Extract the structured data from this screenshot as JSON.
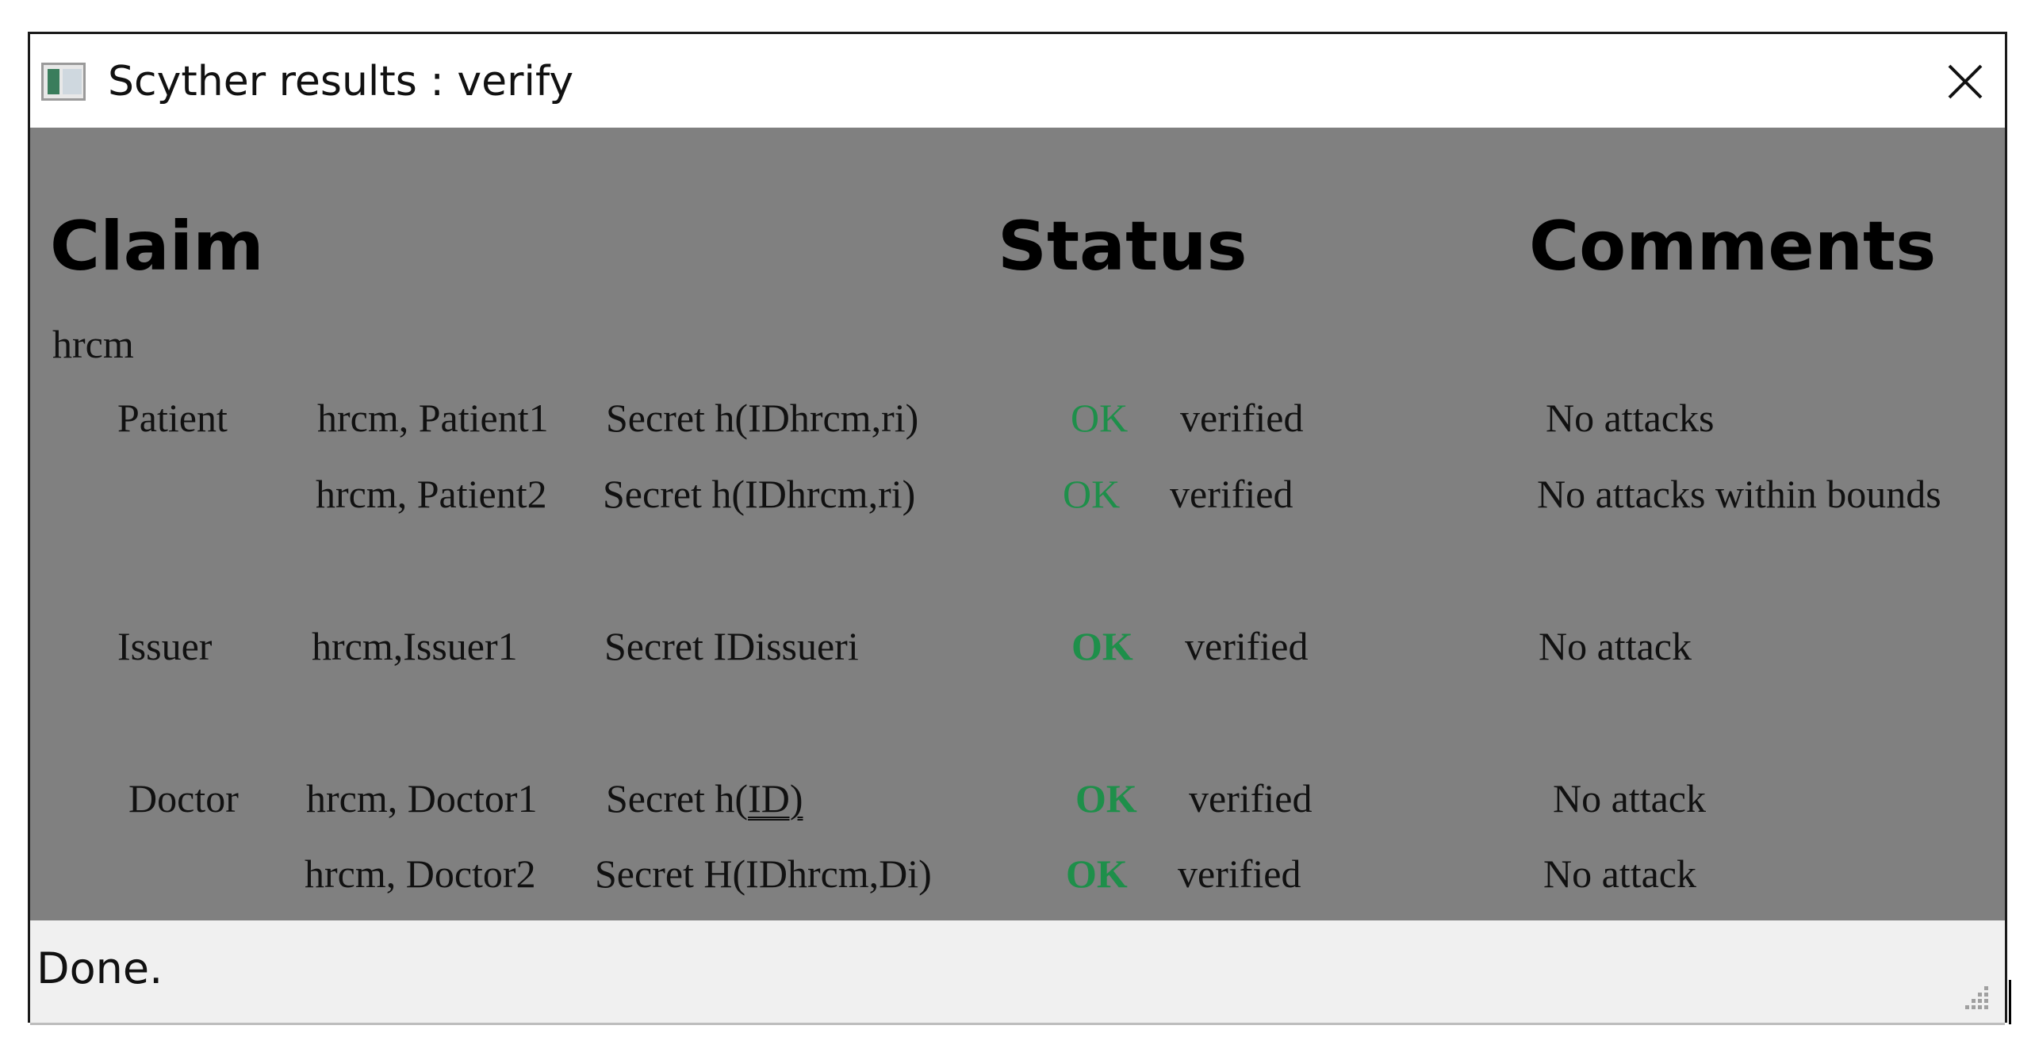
{
  "window": {
    "title": "Scyther results : verify"
  },
  "headers": {
    "claim": "Claim",
    "status": "Status",
    "comments": "Comments"
  },
  "protocol": "hrcm",
  "rows": [
    {
      "role": "Patient",
      "claim_id": "hrcm, Patient1",
      "claim": "Secret h(IDhrcm,ri)",
      "status": "OK",
      "result": "verified",
      "comment": "No attacks"
    },
    {
      "role": "",
      "claim_id": "hrcm, Patient2",
      "claim": "Secret h(IDhrcm,ri)",
      "status": "OK",
      "result": "verified",
      "comment": "No attacks within bounds"
    },
    {
      "role": "Issuer",
      "claim_id": "hrcm,Issuer1",
      "claim": "Secret IDissueri",
      "status": "OK",
      "result": "verified",
      "comment": "No attack"
    },
    {
      "role": "Doctor",
      "claim_id": "hrcm, Doctor1",
      "claim_prefix": "Secret h(",
      "claim_underlined": "ID)",
      "status": "OK",
      "result": "verified",
      "comment": "No attack"
    },
    {
      "role": "",
      "claim_id": "hrcm, Doctor2",
      "claim": "Secret H(IDhrcm,Di)",
      "status": "OK",
      "result": "verified",
      "comment": "No attack"
    }
  ],
  "statusbar": {
    "text": "Done."
  },
  "colors": {
    "content_bg": "#808080",
    "ok": "#1e8f4a",
    "statusbar_bg": "#f0f0f0"
  }
}
